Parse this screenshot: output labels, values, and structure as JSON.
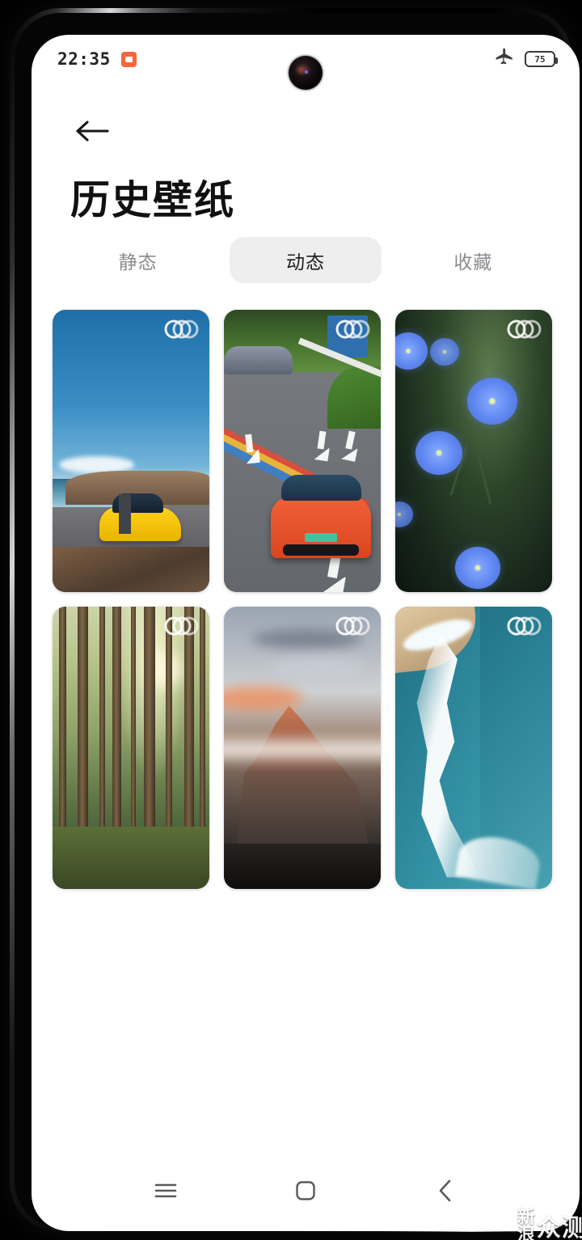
{
  "status_bar": {
    "time": "22:35",
    "recording_icon": "screen-record-icon",
    "airplane_icon": "airplane-mode-icon",
    "battery_level": "75"
  },
  "header": {
    "back_icon": "back-arrow-icon",
    "title": "历史壁纸"
  },
  "tabs": [
    {
      "label": "静态",
      "active": false
    },
    {
      "label": "动态",
      "active": true
    },
    {
      "label": "收藏",
      "active": false
    }
  ],
  "grid": {
    "badge_icon": "live-wallpaper-badge-icon",
    "items": [
      {
        "name": "yellow-sports-car-coast",
        "description": "黄色跑车海岸公路"
      },
      {
        "name": "orange-car-striped-road",
        "description": "橙色轿车彩色车道"
      },
      {
        "name": "blue-flax-flowers",
        "description": "蓝色亚麻花"
      },
      {
        "name": "sunlit-pine-forest",
        "description": "阳光松树林"
      },
      {
        "name": "sunset-mountain-clouds",
        "description": "日落山峰云海"
      },
      {
        "name": "turquoise-ocean-wave",
        "description": "碧绿海浪沙滩"
      }
    ]
  },
  "nav_bar": {
    "recents_icon": "recents-menu-icon",
    "home_icon": "home-square-icon",
    "back_icon": "back-chevron-icon"
  },
  "watermark": {
    "line1": "新",
    "line2": "浪",
    "big": "众测"
  },
  "colors": {
    "accent_record": "#f4683c",
    "tab_active_bg": "#eeeeef",
    "screen_bg": "#ffffff",
    "text_primary": "#111113",
    "text_muted": "#8b8b90"
  }
}
